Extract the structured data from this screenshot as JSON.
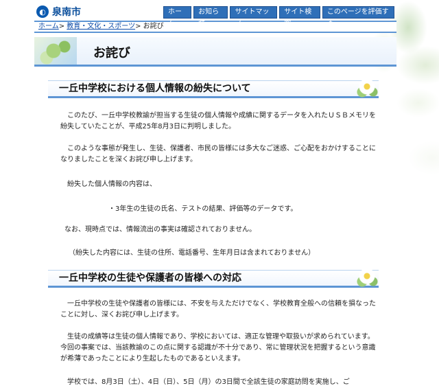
{
  "header": {
    "logo_text": "泉南市",
    "nav": [
      "ホーム",
      "お知らせ",
      "サイトマップ",
      "サイト検索",
      "このページを評価する"
    ]
  },
  "breadcrumb": {
    "items": [
      "ホーム",
      "教育・文化・スポーツ"
    ],
    "separator": ">",
    "current": "お詫び"
  },
  "page_title": "お詫び",
  "section1": {
    "heading": "一丘中学校における個人情報の紛失について",
    "paragraphs": [
      "　このたび、一丘中学校教諭が担当する生徒の個人情報や成績に関するデータを入れたＵＳＢメモリを紛失していたことが、平成25年8月3日に判明しました。",
      "　このような事態が発生し、生徒、保護者、市民の皆様には多大なご迷惑、ご心配をおかけすることになりましたことを深くお詫び申し上げます。",
      "　紛失した個人情報の内容は、",
      "・3年生の生徒の氏名、テストの結果、評価等のデータです。",
      "なお、現時点では、情報流出の事実は確認されておりません。",
      "（紛失した内容には、生徒の住所、電話番号、生年月日は含まれておりません）"
    ]
  },
  "section2": {
    "heading": "一丘中学校の生徒や保護者の皆様への対応",
    "paragraphs": [
      "　一丘中学校の生徒や保護者の皆様には、不安を与えただけでなく、学校教育全般への信頼を損なったことに対し、深くお詫び申し上げます。",
      "　生徒の成績等は生徒の個人情報であり、学校においては、適正な管理や取扱いが求められています。今回の事案では、当該教諭のこの点に関する認識が不十分であり、常に管理状況を把握するという意識が希薄であったことにより生起したものであるといえます。",
      "　学校では、8月3日（土）、4日（日）、5日（月）の3日間で全該生徒の家庭訪問を実施し、ご"
    ]
  }
}
